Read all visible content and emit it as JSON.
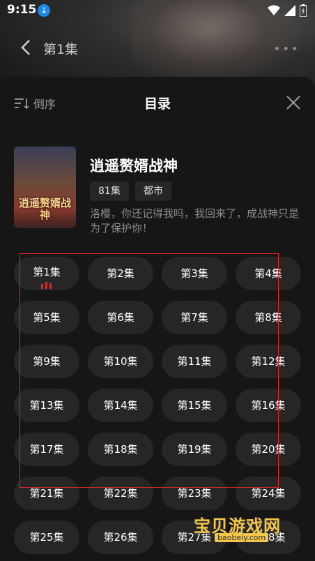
{
  "status": {
    "time": "9:15"
  },
  "nav": {
    "title": "第1集"
  },
  "sheet": {
    "sort_label": "倒序",
    "title": "目录"
  },
  "drama": {
    "cover_text": "逍遥赘婿战神",
    "title": "逍遥赘婿战神",
    "episodes_count": "81集",
    "genre": "都市",
    "description": "洛樱，你还记得我吗，我回来了，成战神只是为了保护你！"
  },
  "episodes": [
    "第1集",
    "第2集",
    "第3集",
    "第4集",
    "第5集",
    "第6集",
    "第7集",
    "第8集",
    "第9集",
    "第10集",
    "第11集",
    "第12集",
    "第13集",
    "第14集",
    "第15集",
    "第16集",
    "第17集",
    "第18集",
    "第19集",
    "第20集",
    "第21集",
    "第22集",
    "第23集",
    "第24集",
    "第25集",
    "第26集",
    "第27集",
    "第28集"
  ],
  "current_episode_index": 0,
  "watermark": {
    "name": "宝贝游戏网",
    "url": "baobeiy.com"
  },
  "colors": {
    "accent": "#e02828",
    "sheet_bg": "#161616",
    "chip_bg": "#262626"
  }
}
